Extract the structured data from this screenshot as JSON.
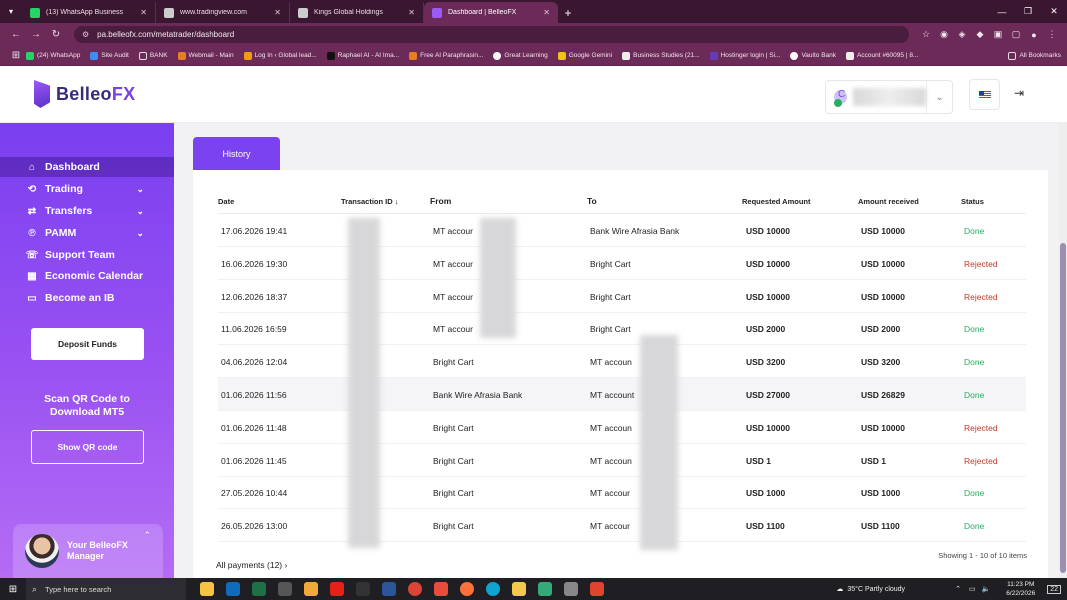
{
  "browser": {
    "tabs": [
      {
        "title": "(13) WhatsApp Business",
        "color": "#25d366",
        "active": false
      },
      {
        "title": "www.tradingview.com",
        "color": "#cccccc",
        "active": false
      },
      {
        "title": "Kings Global Holdings",
        "color": "#cccccc",
        "active": false
      },
      {
        "title": "Dashboard | BelleoFX",
        "color": "#9b59f5",
        "active": true
      }
    ],
    "url": "pa.belleofx.com/metatrader/dashboard",
    "bookmarks": [
      "(24) WhatsApp",
      "Site Audit",
      "BANK",
      "Webmail - Main",
      "Log In ‹ Global lead...",
      "Raphael AI - AI Ima...",
      "Free AI Paraphrasin...",
      "Great Learning",
      "Google Gemini",
      "Business Studies (21...",
      "Hostinger login | Si...",
      "Vaulto Bank",
      "Account #60095 | 8..."
    ],
    "all_bookmarks": "All Bookmarks"
  },
  "header": {
    "logo_a": "Belleo",
    "logo_b": "FX",
    "user_initial": "C"
  },
  "sidebar": {
    "items": [
      {
        "label": "Dashboard",
        "icon": "home-icon",
        "glyph": "⌂"
      },
      {
        "label": "Trading",
        "icon": "chart-icon",
        "glyph": "⟳"
      },
      {
        "label": "Transfers",
        "icon": "transfer-icon",
        "glyph": "⇄"
      },
      {
        "label": "PAMM",
        "icon": "pamm-icon",
        "glyph": "℗"
      },
      {
        "label": "Support Team",
        "icon": "headset-icon",
        "glyph": "☏"
      },
      {
        "label": "Economic Calendar",
        "icon": "calendar-icon",
        "glyph": "▦"
      },
      {
        "label": "Become an IB",
        "icon": "briefcase-icon",
        "glyph": "▭"
      }
    ],
    "deposit_label": "Deposit Funds",
    "scan_text_1": "Scan QR Code to",
    "scan_text_2": "Download MT5",
    "qr_label": "Show QR code",
    "manager_1": "Your BelleoFX",
    "manager_2": "Manager"
  },
  "history": {
    "tab_label": "History",
    "columns": [
      "Date",
      "Transaction ID ↓",
      "From",
      "To",
      "Requested Amount",
      "Amount received",
      "Status"
    ],
    "rows": [
      {
        "date": "17.06.2026 19:41",
        "from": "MT accour",
        "to": "Bank Wire Afrasia Bank",
        "requested": "USD 10000",
        "received": "USD 10000",
        "status": "Done"
      },
      {
        "date": "16.06.2026 19:30",
        "from": "MT accour",
        "to": "Bright Cart",
        "requested": "USD 10000",
        "received": "USD 10000",
        "status": "Rejected"
      },
      {
        "date": "12.06.2026 18:37",
        "from": "MT accour",
        "to": "Bright Cart",
        "requested": "USD 10000",
        "received": "USD 10000",
        "status": "Rejected"
      },
      {
        "date": "11.06.2026 16:59",
        "from": "MT accour",
        "to": "Bright Cart",
        "requested": "USD 2000",
        "received": "USD 2000",
        "status": "Done"
      },
      {
        "date": "04.06.2026 12:04",
        "from": "Bright Cart",
        "to": "MT accoun",
        "requested": "USD 3200",
        "received": "USD 3200",
        "status": "Done"
      },
      {
        "date": "01.06.2026 11:56",
        "from": "Bank Wire Afrasia Bank",
        "to": "MT account",
        "requested": "USD 27000",
        "received": "USD 26829",
        "status": "Done"
      },
      {
        "date": "01.06.2026 11:48",
        "from": "Bright Cart",
        "to": "MT accoun",
        "requested": "USD 10000",
        "received": "USD 10000",
        "status": "Rejected"
      },
      {
        "date": "01.06.2026 11:45",
        "from": "Bright Cart",
        "to": "MT accoun",
        "requested": "USD 1",
        "received": "USD 1",
        "status": "Rejected"
      },
      {
        "date": "27.05.2026 10:44",
        "from": "Bright Cart",
        "to": "MT accour",
        "requested": "USD 1000",
        "received": "USD 1000",
        "status": "Done"
      },
      {
        "date": "26.05.2026 13:00",
        "from": "Bright Cart",
        "to": "MT accour",
        "requested": "USD 1100",
        "received": "USD 1100",
        "status": "Done"
      }
    ],
    "all_payments": "All payments (12)",
    "showing": "Showing 1 - 10 of 10 items"
  },
  "taskbar": {
    "search_placeholder": "Type here to search",
    "weather": "35°C  Partly cloudy",
    "time": "11:23 PM",
    "date": "6/22/2026",
    "notif": "22"
  },
  "colors": {
    "accent": "#7b42ef",
    "done": "#27ae60",
    "rejected": "#c0392b",
    "chrome": "#6b2a57"
  }
}
